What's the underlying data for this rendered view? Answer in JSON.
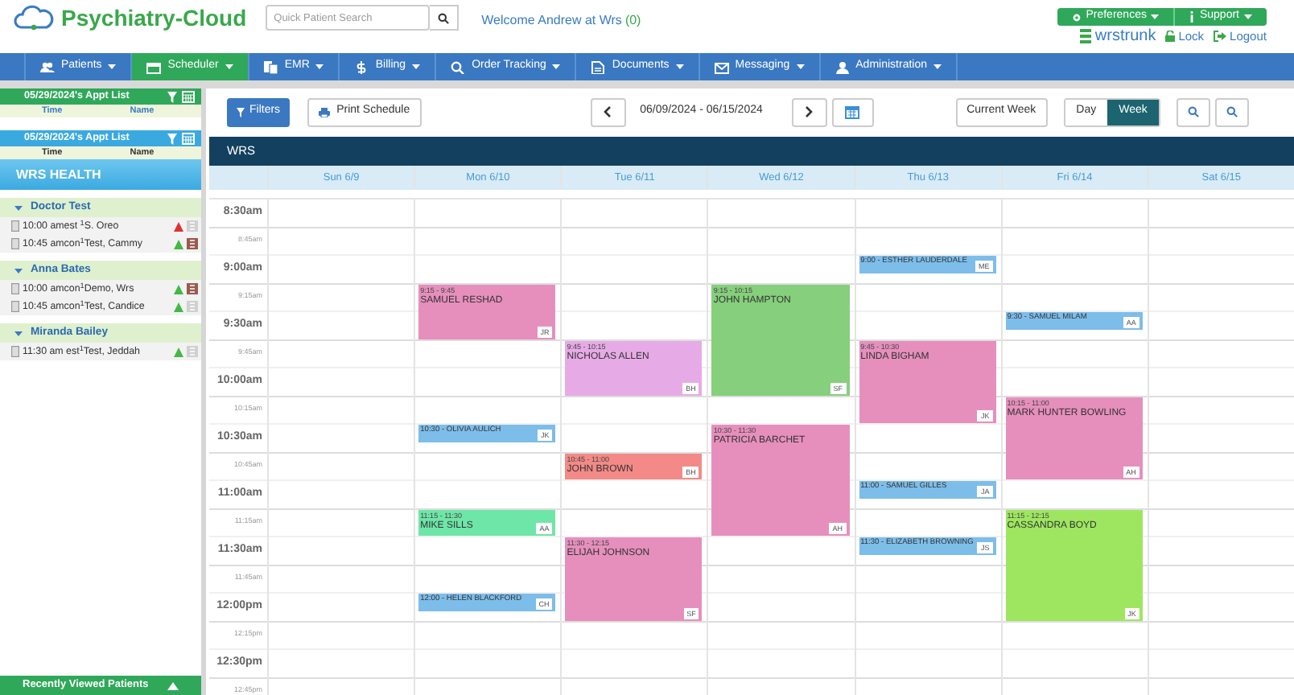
{
  "header": {
    "logo": "Psychiatry-Cloud",
    "search": {
      "placeholder": "Quick Patient Search"
    },
    "welcome": "Welcome Andrew at Wrs",
    "welcome_count": "(0)",
    "buttons": [
      "Preferences",
      "Support"
    ],
    "user": "wrstrunk",
    "links": [
      "Lock",
      "Logout"
    ]
  },
  "nav": [
    {
      "label": "Patients",
      "selected": false
    },
    {
      "label": "Scheduler",
      "selected": true
    },
    {
      "label": "EMR",
      "selected": false
    },
    {
      "label": "Billing",
      "selected": false
    },
    {
      "label": "Order Tracking",
      "selected": false
    },
    {
      "label": "Documents",
      "selected": false
    },
    {
      "label": "Messaging",
      "selected": false
    },
    {
      "label": "Administration",
      "selected": false
    }
  ],
  "sidebar": {
    "lists": [
      {
        "kind": "green",
        "title": "05/29/2024's Appt List",
        "columns": [
          "Time",
          "Name"
        ]
      },
      {
        "kind": "blue",
        "title": "05/29/2024's Appt List",
        "columns": [
          "Time",
          "Name"
        ]
      }
    ],
    "practice": "WRS HEALTH",
    "providers": [
      {
        "name": "Doctor Test",
        "expanded": true,
        "appointments": [
          {
            "text": "10:00 amest $^{1}$S. Oreo",
            "color": "#e03030",
            "note": false
          },
          {
            "text": "10:45 amcon$^{1}$Test, Cammy",
            "color": "#44b844",
            "note": true
          }
        ]
      },
      {
        "name": "Anna Bates",
        "expanded": true,
        "appointments": [
          {
            "text": "10:00 amcon$^{1}$Demo, Wrs",
            "color": "#44b844",
            "note": true
          },
          {
            "text": "10:45 amcon$^{1}$Test, Candice",
            "color": "#44b844",
            "note": false
          }
        ]
      },
      {
        "name": "Miranda Bailey",
        "expanded": true,
        "appointments": [
          {
            "text": "11:30 am est$^{1}$Test, Jeddah",
            "color": "#44b844",
            "note": false
          }
        ]
      }
    ],
    "footer": "Recently Viewed Patients"
  },
  "toolbar": {
    "filters": "Filters",
    "print": "Print Schedule",
    "range": "06/09/2024 - 06/15/2024",
    "current": "Current Week",
    "views": [
      {
        "label": "Day",
        "selected": false
      },
      {
        "label": "Week",
        "selected": true
      }
    ]
  },
  "calendar": {
    "title": "WRS",
    "slots": [
      {
        "label": "8:30am",
        "kind": "major"
      },
      {
        "label": "8:45am",
        "kind": "minor"
      },
      {
        "label": "9:00am",
        "kind": "major"
      },
      {
        "label": "9:15am",
        "kind": "minor"
      },
      {
        "label": "9:30am",
        "kind": "major"
      },
      {
        "label": "9:45am",
        "kind": "minor"
      },
      {
        "label": "10:00am",
        "kind": "major"
      },
      {
        "label": "10:15am",
        "kind": "minor"
      },
      {
        "label": "10:30am",
        "kind": "major"
      },
      {
        "label": "10:45am",
        "kind": "minor"
      },
      {
        "label": "11:00am",
        "kind": "major"
      },
      {
        "label": "11:15am",
        "kind": "minor"
      },
      {
        "label": "11:30am",
        "kind": "major"
      },
      {
        "label": "11:45am",
        "kind": "minor"
      },
      {
        "label": "12:00pm",
        "kind": "major"
      },
      {
        "label": "12:15pm",
        "kind": "minor"
      },
      {
        "label": "12:30pm",
        "kind": "major"
      },
      {
        "label": "12:45pm",
        "kind": "minor"
      }
    ],
    "days": [
      {
        "label": "Sun 6/9"
      },
      {
        "label": "Mon 6/10",
        "events": [
          {
            "kind": "block",
            "time": "9:15 - 9:45",
            "name": "SAMUEL RESHAD",
            "initials": "JR",
            "color": "#e68fbd"
          },
          {
            "kind": "bar",
            "label": "10:30 - OLIVIA AULICH",
            "initials": "JK",
            "color": "#7dbde9"
          },
          {
            "kind": "block",
            "time": "11:15 - 11:30",
            "name": "MIKE SILLS",
            "initials": "AA",
            "color": "#6ee6a8"
          },
          {
            "kind": "bar",
            "label": "12:00 - HELEN BLACKFORD",
            "initials": "CH",
            "color": "#7dbde9"
          }
        ]
      },
      {
        "label": "Tue 6/11",
        "events": [
          {
            "kind": "block",
            "time": "9:45 - 10:15",
            "name": "NICHOLAS ALLEN",
            "initials": "BH",
            "color": "#e6abe6"
          },
          {
            "kind": "block",
            "time": "10:45 - 11:00",
            "name": "JOHN BROWN",
            "initials": "BH",
            "color": "#f38a87"
          },
          {
            "kind": "block",
            "time": "11:30 - 12:15",
            "name": "ELIJAH JOHNSON",
            "initials": "SF",
            "color": "#e68fbd"
          }
        ]
      },
      {
        "label": "Wed 6/12",
        "events": [
          {
            "kind": "block",
            "time": "9:15 - 10:15",
            "name": "JOHN HAMPTON",
            "initials": "SF",
            "color": "#86cf7c"
          },
          {
            "kind": "block",
            "time": "10:30 - 11:30",
            "name": "PATRICIA BARCHET",
            "initials": "AH",
            "color": "#e68fbd"
          }
        ]
      },
      {
        "label": "Thu 6/13",
        "events": [
          {
            "kind": "bar",
            "label": "9:00 - ESTHER LAUDERDALE",
            "initials": "ME",
            "color": "#7dbde9"
          },
          {
            "kind": "block",
            "time": "9:45 - 10:30",
            "name": "LINDA BIGHAM",
            "initials": "JK",
            "color": "#e68fbd"
          },
          {
            "kind": "bar",
            "label": "11:00 - SAMUEL GILLES",
            "initials": "JA",
            "color": "#7dbde9"
          },
          {
            "kind": "bar",
            "label": "11:30 - ELIZABETH BROWNING",
            "initials": "JS",
            "color": "#7dbde9"
          }
        ]
      },
      {
        "label": "Fri 6/14",
        "events": [
          {
            "kind": "bar",
            "label": "9:30 - SAMUEL MILAM",
            "initials": "AA",
            "color": "#7dbde9"
          },
          {
            "kind": "block",
            "time": "10:15 - 11:00",
            "name": "MARK HUNTER BOWLING",
            "initials": "AH",
            "color": "#e68fbd"
          },
          {
            "kind": "block",
            "time": "11:15 - 12:15",
            "name": "CASSANDRA BOYD",
            "initials": "JK",
            "color": "#9ee660"
          }
        ]
      },
      {
        "label": "Sat 6/15"
      }
    ]
  }
}
